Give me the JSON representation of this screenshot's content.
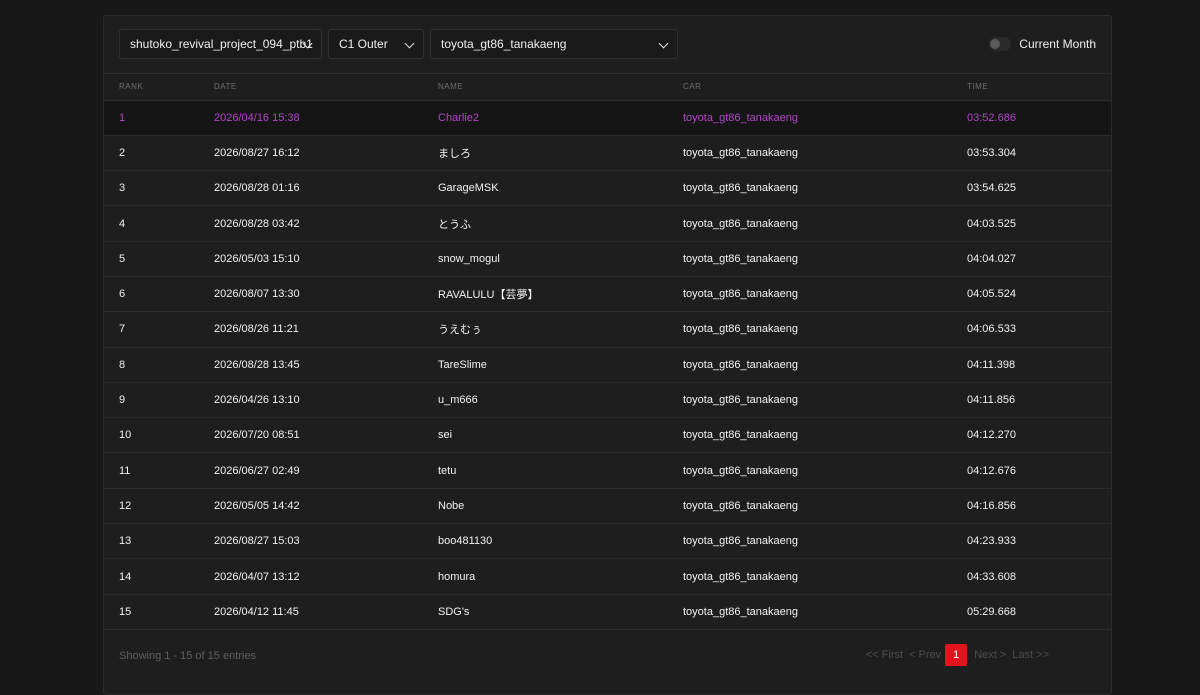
{
  "filters": {
    "server": "shutoko_revival_project_094_ptb1",
    "track": "C1 Outer",
    "car": "toyota_gt86_tanakaeng",
    "current_month_label": "Current Month",
    "current_month_enabled": false
  },
  "table": {
    "headers": {
      "rank": "RANK",
      "date": "DATE",
      "name": "NAME",
      "car": "CAR",
      "time": "TIME"
    },
    "rows": [
      {
        "rank": "1",
        "date": "2026/04/16 15:38",
        "name": "Charlie2",
        "car": "toyota_gt86_tanakaeng",
        "time": "03:52.686"
      },
      {
        "rank": "2",
        "date": "2026/08/27 16:12",
        "name": "ましろ",
        "car": "toyota_gt86_tanakaeng",
        "time": "03:53.304"
      },
      {
        "rank": "3",
        "date": "2026/08/28 01:16",
        "name": "GarageMSK",
        "car": "toyota_gt86_tanakaeng",
        "time": "03:54.625"
      },
      {
        "rank": "4",
        "date": "2026/08/28 03:42",
        "name": "とうふ",
        "car": "toyota_gt86_tanakaeng",
        "time": "04:03.525"
      },
      {
        "rank": "5",
        "date": "2026/05/03 15:10",
        "name": "snow_mogul",
        "car": "toyota_gt86_tanakaeng",
        "time": "04:04.027"
      },
      {
        "rank": "6",
        "date": "2026/08/07 13:30",
        "name": "RAVALULU【芸夢】",
        "car": "toyota_gt86_tanakaeng",
        "time": "04:05.524"
      },
      {
        "rank": "7",
        "date": "2026/08/26 11:21",
        "name": "うえむぅ",
        "car": "toyota_gt86_tanakaeng",
        "time": "04:06.533"
      },
      {
        "rank": "8",
        "date": "2026/08/28 13:45",
        "name": "TareSlime",
        "car": "toyota_gt86_tanakaeng",
        "time": "04:11.398"
      },
      {
        "rank": "9",
        "date": "2026/04/26 13:10",
        "name": "u_m666",
        "car": "toyota_gt86_tanakaeng",
        "time": "04:11.856"
      },
      {
        "rank": "10",
        "date": "2026/07/20 08:51",
        "name": "sei",
        "car": "toyota_gt86_tanakaeng",
        "time": "04:12.270"
      },
      {
        "rank": "11",
        "date": "2026/06/27 02:49",
        "name": "tetu",
        "car": "toyota_gt86_tanakaeng",
        "time": "04:12.676"
      },
      {
        "rank": "12",
        "date": "2026/05/05 14:42",
        "name": "Nobe",
        "car": "toyota_gt86_tanakaeng",
        "time": "04:16.856"
      },
      {
        "rank": "13",
        "date": "2026/08/27 15:03",
        "name": "boo481130",
        "car": "toyota_gt86_tanakaeng",
        "time": "04:23.933"
      },
      {
        "rank": "14",
        "date": "2026/04/07 13:12",
        "name": "homura",
        "car": "toyota_gt86_tanakaeng",
        "time": "04:33.608"
      },
      {
        "rank": "15",
        "date": "2026/04/12 11:45",
        "name": "SDG's",
        "car": "toyota_gt86_tanakaeng",
        "time": "05:29.668"
      }
    ]
  },
  "footer": {
    "showing": "Showing 1 - 15 of 15 entries",
    "pager": {
      "first": "<< First",
      "prev": "< Prev",
      "current": "1",
      "next": "Next >",
      "last": "Last >>"
    }
  },
  "colors": {
    "highlight_row": "#b246c9",
    "active_page": "#e0151b",
    "background": "#181818"
  }
}
